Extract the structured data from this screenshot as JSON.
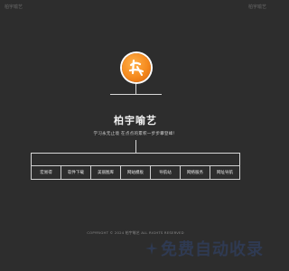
{
  "corner": {
    "left_text": "柏宇喻艺",
    "right_text": "柏宇喻艺"
  },
  "logo": {
    "icon": "chinese-character-logo-icon",
    "colors": {
      "fill": "#f58a1e",
      "ring": "#ffffff"
    }
  },
  "site": {
    "title": "柏宇喻艺",
    "subtitle": "学习永无止境 在点点的累积一步步攀登峰！"
  },
  "nav": {
    "items": [
      {
        "label": "宏易得"
      },
      {
        "label": "软件下载"
      },
      {
        "label": "美丽图库"
      },
      {
        "label": "网站模板"
      },
      {
        "label": "导航站"
      },
      {
        "label": "网络服务"
      },
      {
        "label": "网址导航"
      }
    ]
  },
  "footer": {
    "copyright": "COPYRIGHT © 2024 柏宇喻艺 ALL RIGHTS RESERVED"
  },
  "watermark": {
    "text": "免费自动收录",
    "icon": "sparkle-icon",
    "color": "#2f3a52"
  }
}
